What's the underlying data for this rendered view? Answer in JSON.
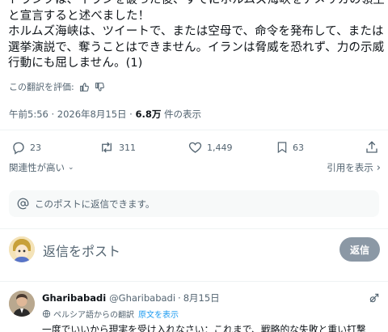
{
  "post": {
    "text": "トランプは、イランを破った後、すでにホルムズ海峡をアメリカの領土と宣言すると述べました！\nホルムズ海峡は、ツイートで、または空母で、命令を発布して、または選挙演説で、奪うことはできません。イランは脅威を恐れず、力の示威行動にも屈しません。(1)",
    "rate_label": "この翻訳を評価:",
    "time": "午前5:56 · 2026年8月15日 · ",
    "views_count": "6.8万",
    "views_label": " 件の表示"
  },
  "actions": {
    "replies": "23",
    "reposts": "311",
    "likes": "1,449",
    "bookmarks": "63"
  },
  "sort": {
    "relevance_label": "関連性が高い",
    "quote_label": "引用を表示"
  },
  "reply_notice": "このポストに返信できます。",
  "composer": {
    "placeholder": "返信をポスト",
    "button_label": "返信"
  },
  "reply": {
    "name": "Gharibabadi",
    "handle": "@Gharibabadi",
    "date": "8月15日",
    "translated_from": "ペルシア語からの翻訳",
    "show_original": "原文を表示",
    "text": "一度でいいから現実を受け入れなさい：これまで、戦略的な失敗と重い打撃"
  },
  "colors": {
    "text_primary": "#0f1419",
    "text_secondary": "#536471",
    "accent": "#1d9bf0",
    "button_disabled": "#8b98a5"
  }
}
